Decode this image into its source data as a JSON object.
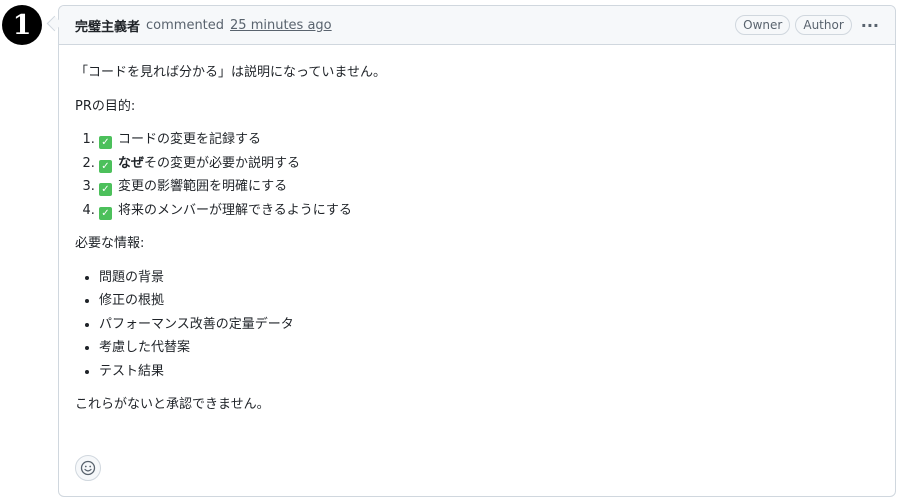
{
  "comment": {
    "avatar_text": "1",
    "author": "完璧主義者",
    "verb": "commented",
    "time": "25 minutes ago",
    "badges": [
      "Owner",
      "Author"
    ],
    "more_label": "···"
  },
  "body": {
    "intro": "「コードを見れば分かる」は説明になっていません。",
    "purpose_heading": "PRの目的:",
    "purpose_items": [
      {
        "bold": "",
        "text": "コードの変更を記録する"
      },
      {
        "bold": "なぜ",
        "text": "その変更が必要か説明する"
      },
      {
        "bold": "",
        "text": "変更の影響範囲を明確にする"
      },
      {
        "bold": "",
        "text": "将来のメンバーが理解できるようにする"
      }
    ],
    "required_heading": "必要な情報:",
    "required_items": [
      "問題の背景",
      "修正の根拠",
      "パフォーマンス改善の定量データ",
      "考慮した代替案",
      "テスト結果"
    ],
    "closing": "これらがないと承認できません。"
  },
  "icons": {
    "check": "check-box-icon",
    "reaction": "smiley-icon",
    "more": "kebab-icon"
  },
  "colors": {
    "check": "#4cc05b",
    "border": "#d0d7de",
    "header_bg": "#f6f8fa"
  }
}
